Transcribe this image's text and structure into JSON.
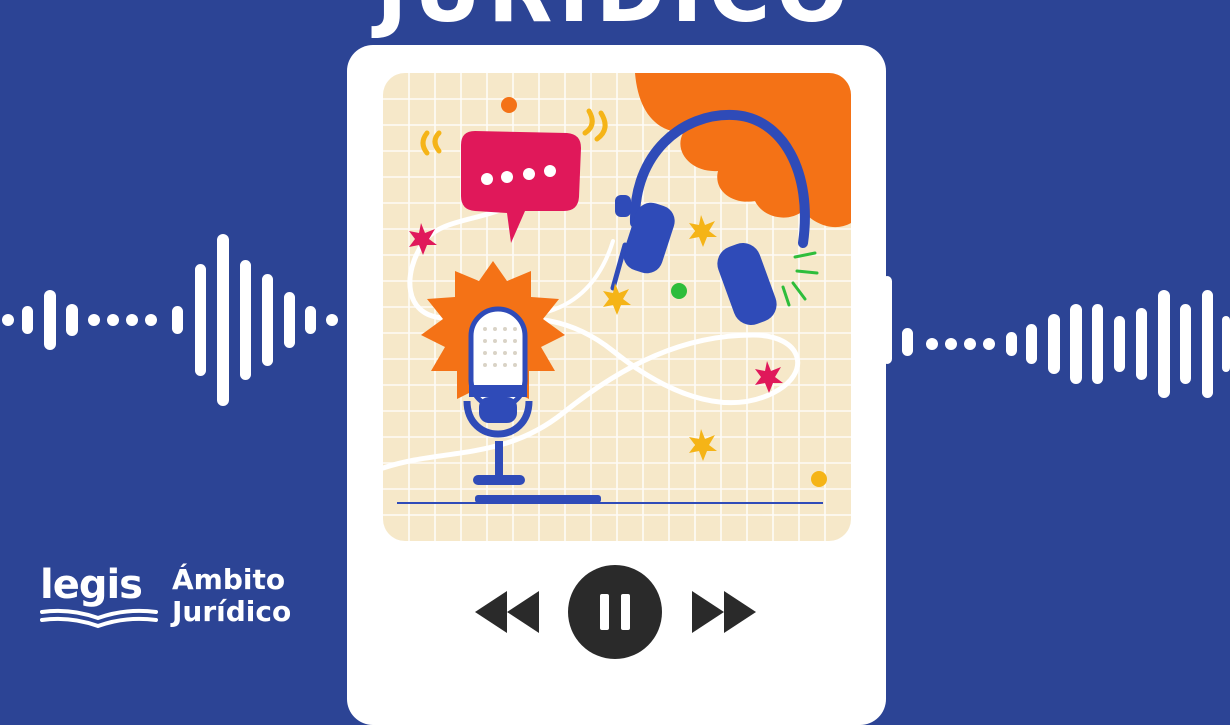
{
  "header": {
    "title": "JURÍDICO"
  },
  "brand": {
    "logo_text": "legis",
    "product_line1": "Ámbito",
    "product_line2": "Jurídico"
  },
  "player": {
    "state": "playing",
    "controls": [
      "rewind",
      "pause",
      "fast-forward"
    ]
  },
  "colors": {
    "background": "#2c4495",
    "card": "#ffffff",
    "art_bg": "#f6e8c9",
    "orange": "#f47216",
    "blue": "#2f4bb8",
    "pink": "#e0185a",
    "yellow": "#f5b417",
    "control_dark": "#2a2a2a"
  }
}
